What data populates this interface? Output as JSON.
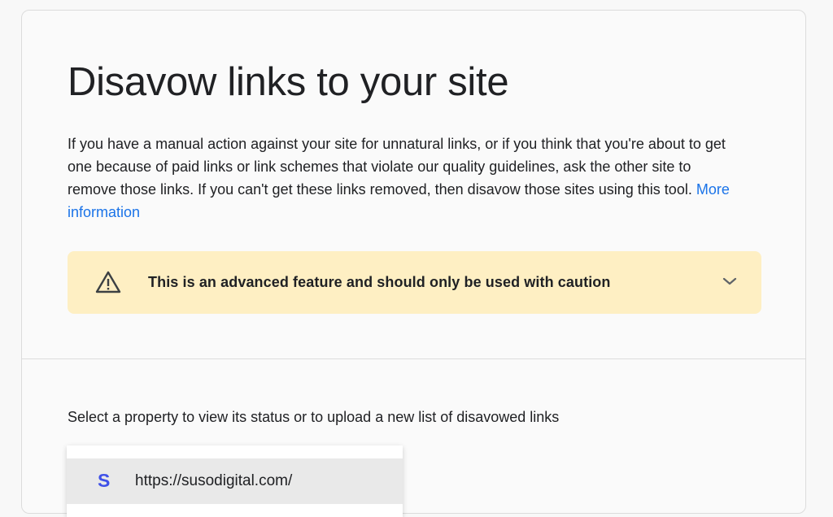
{
  "page": {
    "title": "Disavow links to your site",
    "intro_text": "If you have a manual action against your site for unnatural links, or if you think that you're about to get one because of paid links or link schemes that violate our quality guidelines, ask the other site to remove those links. If you can't get these links removed, then disavow those sites using this tool.",
    "more_info_link": "More information"
  },
  "warning": {
    "icon": "warning-triangle-icon",
    "text": "This is an advanced feature and should only be used with caution",
    "expand_icon": "chevron-down-icon"
  },
  "property_select": {
    "label": "Select a property to view its status or to upload a new list of disavowed links",
    "items": [
      {
        "icon_letter": "S",
        "url": "https://susodigital.com/"
      }
    ]
  },
  "colors": {
    "link": "#1a73e8",
    "warning_bg": "#feefc3",
    "site_icon": "#3f51e8"
  }
}
